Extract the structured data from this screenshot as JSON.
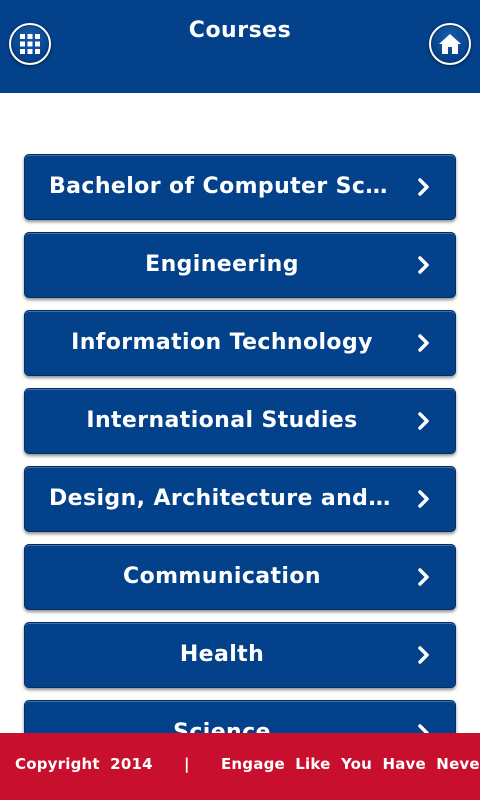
{
  "header": {
    "title": "Courses",
    "menu_icon": "grid-menu-icon",
    "home_icon": "home-icon",
    "background": "#03418a"
  },
  "courses": [
    {
      "label": "Bachelor of Computer Scien..."
    },
    {
      "label": "Engineering"
    },
    {
      "label": "Information Technology"
    },
    {
      "label": "International Studies"
    },
    {
      "label": "Design, Architecture and B..."
    },
    {
      "label": "Communication"
    },
    {
      "label": "Health"
    },
    {
      "label": "Science"
    }
  ],
  "footer": {
    "copyright": "Copyright 2014",
    "separator": "|",
    "tagline": "Engage Like You Have Never Done Before",
    "background": "#c8102e"
  },
  "colors": {
    "primary": "#03418a",
    "accent": "#c8102e",
    "text": "#ffffff"
  }
}
